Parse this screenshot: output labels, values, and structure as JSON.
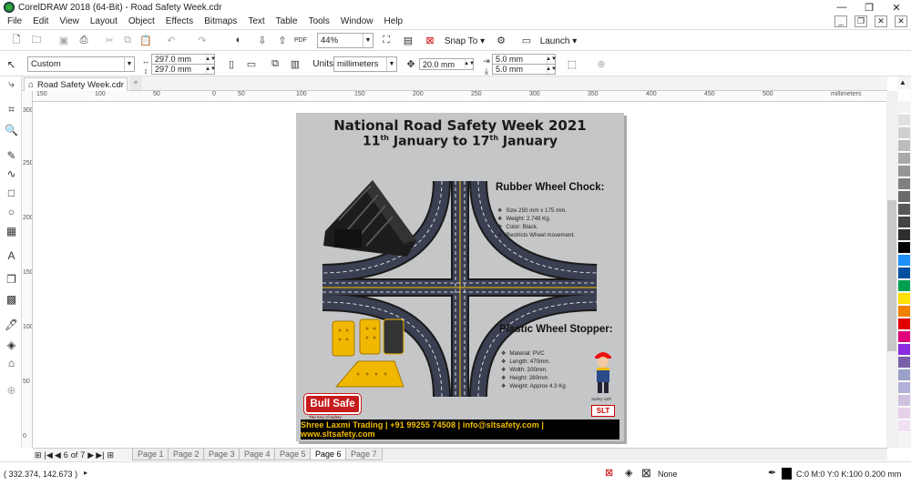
{
  "window": {
    "title": "CorelDRAW 2018 (64-Bit) - Road Safety Week.cdr",
    "minimize": "—",
    "restore": "❐",
    "close": "✕"
  },
  "menu": [
    "File",
    "Edit",
    "View",
    "Layout",
    "Object",
    "Effects",
    "Bitmaps",
    "Text",
    "Table",
    "Tools",
    "Window",
    "Help"
  ],
  "standard": {
    "zoom": "44%",
    "snap_to": "Snap To",
    "launch": "Launch"
  },
  "property": {
    "preset": "Custom",
    "width": "297.0 mm",
    "height": "297.0 mm",
    "units_label": "Units:",
    "units": "millimeters",
    "nudge": "20.0 mm",
    "dup_x": "5.0 mm",
    "dup_y": "5.0 mm"
  },
  "document_tab": {
    "label": "Road Safety Week.cdr",
    "add": "+"
  },
  "ruler": {
    "unit": "millimeters",
    "h_ticks": [
      "150",
      "100",
      "50",
      "0",
      "50",
      "100",
      "150",
      "200",
      "250",
      "300",
      "350",
      "400",
      "450",
      "500"
    ],
    "v_ticks": [
      "300",
      "250",
      "200",
      "150",
      "100",
      "50",
      "0"
    ]
  },
  "artwork": {
    "title1": "National Road Safety Week 2021",
    "title2_a": "11",
    "title2_sup1": "th",
    "title2_b": " January to 17",
    "title2_sup2": "th",
    "title2_c": " January",
    "chock_heading": "Rubber Wheel Chock:",
    "chock_bullets": [
      "Size 250 mm x 175 mm.",
      "Weight: 2.749 Kg.",
      "Color: Black.",
      "Restricts Wheel movement."
    ],
    "stopper_heading": "Plastic Wheel Stopper:",
    "stopper_bullets": [
      "Material: PVC",
      "Length: 470mm.",
      "Width: 200mm.",
      "Height: 280mm.",
      "Weight: Approx 4.3 Kg"
    ],
    "bullet_glyph": "❖",
    "brand": "Bull Safe",
    "brand_tagline": "The Key of Safety",
    "slt": "SLT",
    "slt_tagline": "Safety with",
    "footer": "Shree Laxmi Trading | +91 99255 74508 | info@sltsafety.com | www.sltsafety.com"
  },
  "pages": {
    "current": "6",
    "of": "of",
    "total": "7",
    "tabs": [
      "Page 1",
      "Page 2",
      "Page 3",
      "Page 4",
      "Page 5",
      "Page 6",
      "Page 7"
    ],
    "active_index": 5
  },
  "status": {
    "coords": "( 332.374, 142.673 )",
    "fill": "None",
    "outline": "C:0 M:0 Y:0 K:100  0.200 mm"
  },
  "palette_colors": [
    "#ffffff",
    "#f2f2f2",
    "#e0e0e0",
    "#cfcfcf",
    "#bdbdbd",
    "#a9a9a9",
    "#969696",
    "#808080",
    "#6b6b6b",
    "#575757",
    "#444444",
    "#2e2e2e",
    "#000000",
    "#1e90ff",
    "#0050a0",
    "#00a050",
    "#ffe000",
    "#f08000",
    "#e00000",
    "#e0007a",
    "#8a2be2",
    "#7a60a8",
    "#9aa0c8",
    "#b0b0d8",
    "#d0c0e0",
    "#e8d0e8",
    "#f0e0f0"
  ]
}
